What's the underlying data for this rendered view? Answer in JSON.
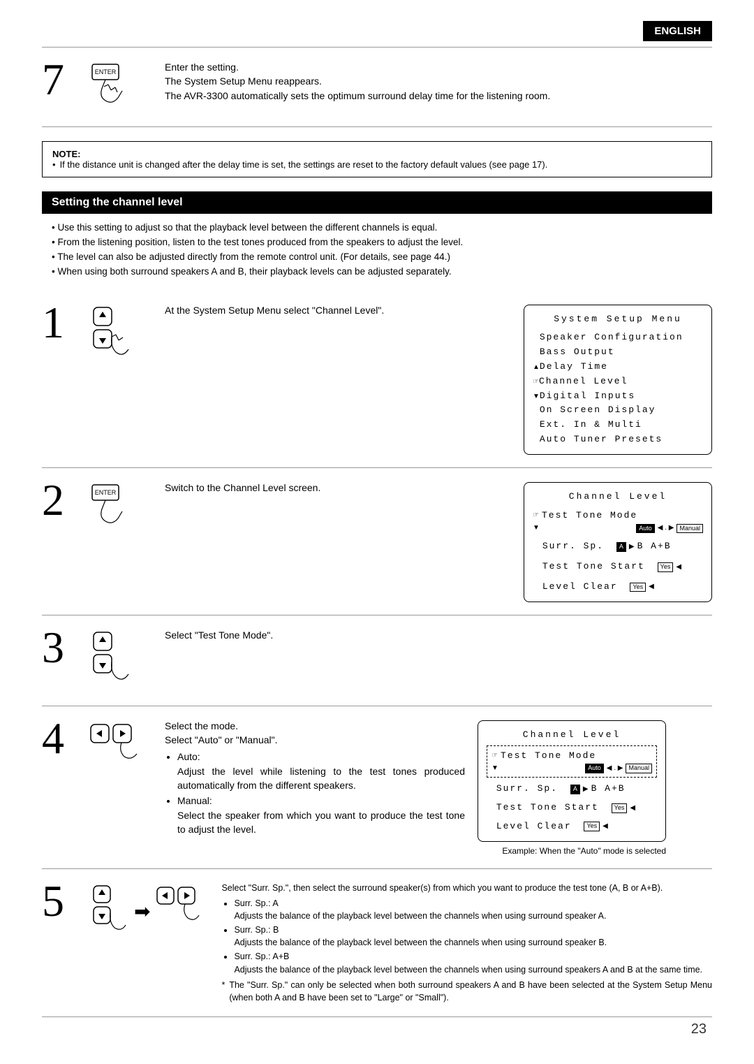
{
  "header": {
    "language_tab": "ENGLISH"
  },
  "step7": {
    "num": "7",
    "enter_label": "ENTER",
    "line1": "Enter the setting.",
    "line2": "The System Setup Menu reappears.",
    "line3": "The AVR-3300 automatically sets the optimum surround delay time for the listening room."
  },
  "note": {
    "title": "NOTE:",
    "bullet": "If the distance unit is changed after the delay time is set, the settings are reset to the factory default values (see page 17)."
  },
  "section_title": "Setting the channel level",
  "intro": {
    "b1": "Use this setting to adjust so that the playback level between the different channels is equal.",
    "b2": "From the listening position, listen to the test tones produced from the speakers to adjust the level.",
    "b3": "The level can also be adjusted directly from the remote control unit. (For details, see page 44.)",
    "b4": "When using both surround speakers A and B, their playback levels can be adjusted separately."
  },
  "step1": {
    "num": "1",
    "text": "At the System Setup Menu select \"Channel Level\".",
    "osd": {
      "title": "System Setup Menu",
      "m1": "Speaker Configuration",
      "m2": "Bass Output",
      "m3": "Delay Time",
      "m4": "Channel Level",
      "m5": "Digital Inputs",
      "m6": "On Screen Display",
      "m7": "Ext. In & Multi",
      "m8": "Auto Tuner Presets"
    }
  },
  "step2": {
    "num": "2",
    "enter_label": "ENTER",
    "text": "Switch to the Channel Level screen.",
    "osd": {
      "title": "Channel Level",
      "r1": "Test Tone Mode",
      "auto": "Auto",
      "manual": "Manual",
      "surr": "Surr. Sp.",
      "a": "A",
      "bab": "B A+B",
      "start": "Test Tone Start",
      "clear": "Level Clear",
      "yes": "Yes"
    }
  },
  "step3": {
    "num": "3",
    "text": "Select \"Test Tone Mode\"."
  },
  "step4": {
    "num": "4",
    "l1": "Select the mode.",
    "l2": "Select \"Auto\" or \"Manual\".",
    "auto_h": "Auto:",
    "auto_t": "Adjust the level while listening to the test tones produced automatically from the different speakers.",
    "man_h": "Manual:",
    "man_t": "Select the speaker from which you want to produce the test tone to adjust the level.",
    "osd_caption": "Example: When the \"Auto\" mode is selected",
    "osd": {
      "title": "Channel Level",
      "r1": "Test Tone Mode",
      "auto": "Auto",
      "manual": "Manual",
      "surr": "Surr. Sp.",
      "a": "A",
      "bab": "B A+B",
      "start": "Test Tone Start",
      "clear": "Level Clear",
      "yes": "Yes"
    }
  },
  "step5": {
    "num": "5",
    "lead": "Select \"Surr. Sp.\", then select the surround speaker(s) from which you want to produce the test tone (A, B or A+B).",
    "o1h": "Surr. Sp.: A",
    "o1t": "Adjusts the balance of the playback level between the channels when using surround speaker A.",
    "o2h": "Surr. Sp.: B",
    "o2t": "Adjusts the balance of the playback level between the channels when using surround speaker B.",
    "o3h": "Surr. Sp.: A+B",
    "o3t": "Adjusts the balance of the playback level between the channels when using surround speakers A and B at the same time.",
    "foot": "The \"Surr. Sp.\" can only be selected when both surround speakers A and B have been selected at the System Setup Menu (when both A and B have been set to \"Large\" or \"Small\")."
  },
  "page_number": "23"
}
